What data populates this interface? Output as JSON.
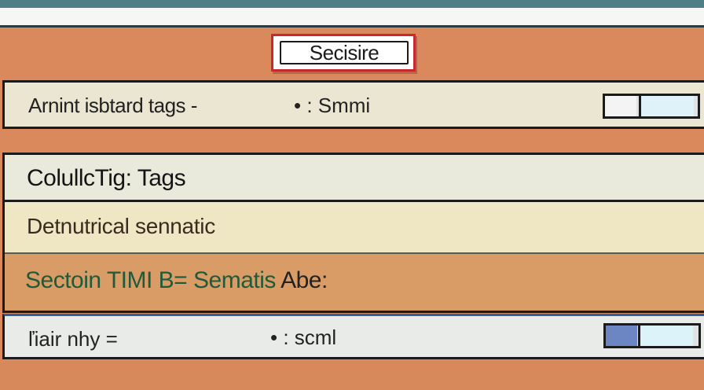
{
  "header": {
    "title": "Secisire"
  },
  "setting_rows": [
    {
      "label": "Arnint isbtard tags -",
      "value": "• : Smmi",
      "toggle_on": false
    },
    {
      "label": "ľiair nhy =",
      "value": "• : scml",
      "toggle_on": true
    }
  ],
  "section": {
    "heading": "ColullcTig: Tags",
    "subheading": "Detnutrical sennatic",
    "footer_text": "Sectoin TIMI B= Sematis",
    "footer_suffix": " Abe:"
  },
  "colors": {
    "background": "#d9895c",
    "title_border": "#c8292d",
    "toggle_active": "#6b86c2",
    "footer_text": "#1f5a3a"
  },
  "icons": {
    "toggle_1": "toggle-switch",
    "toggle_2": "toggle-switch"
  }
}
